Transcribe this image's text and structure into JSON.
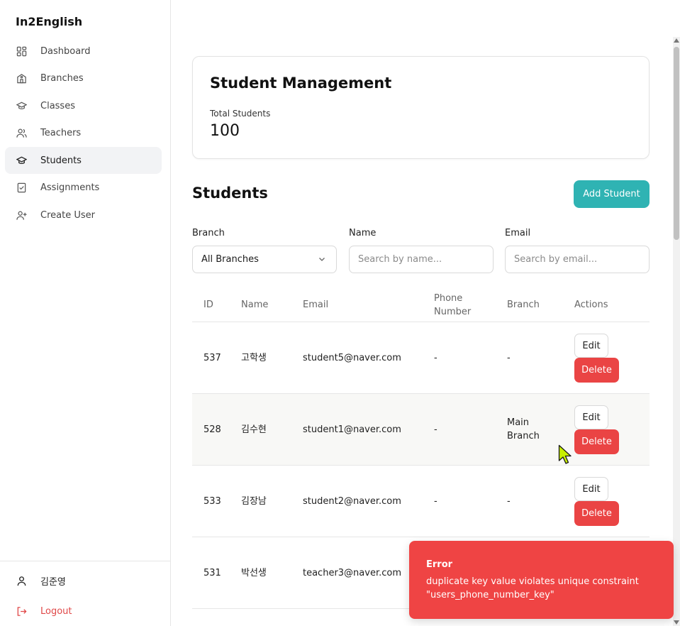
{
  "app": {
    "brand": "In2English"
  },
  "sidebar": {
    "items": [
      {
        "label": "Dashboard",
        "icon": "dashboard-icon"
      },
      {
        "label": "Branches",
        "icon": "building-icon"
      },
      {
        "label": "Classes",
        "icon": "graduation-cap-icon"
      },
      {
        "label": "Teachers",
        "icon": "users-icon"
      },
      {
        "label": "Students",
        "icon": "graduation-cap-icon",
        "active": true
      },
      {
        "label": "Assignments",
        "icon": "clipboard-check-icon"
      },
      {
        "label": "Create User",
        "icon": "user-plus-icon"
      }
    ],
    "user_name": "김준영",
    "logout_label": "Logout"
  },
  "summary": {
    "title": "Student Management",
    "total_label": "Total Students",
    "total_value": "100"
  },
  "students": {
    "title": "Students",
    "add_button": "Add Student",
    "filters": {
      "branch_label": "Branch",
      "branch_value": "All Branches",
      "name_label": "Name",
      "name_placeholder": "Search by name...",
      "email_label": "Email",
      "email_placeholder": "Search by email..."
    },
    "columns": [
      "ID",
      "Name",
      "Email",
      "Phone Number",
      "Branch",
      "Actions"
    ],
    "rows": [
      {
        "id": "537",
        "name": "고학생",
        "email": "student5@naver.com",
        "phone": "-",
        "branch": "-"
      },
      {
        "id": "528",
        "name": "김수현",
        "email": "student1@naver.com",
        "phone": "-",
        "branch": "Main Branch"
      },
      {
        "id": "533",
        "name": "김장남",
        "email": "student2@naver.com",
        "phone": "-",
        "branch": "-"
      },
      {
        "id": "531",
        "name": "박선생",
        "email": "teacher3@naver.com",
        "phone": "",
        "branch": ""
      }
    ],
    "edit_label": "Edit",
    "delete_label": "Delete"
  },
  "toast": {
    "title": "Error",
    "message": "duplicate key value violates unique constraint \"users_phone_number_key\""
  },
  "colors": {
    "accent": "#2fb3b3",
    "danger": "#ea4444",
    "toast": "#ef4444",
    "logout": "#e04848"
  }
}
